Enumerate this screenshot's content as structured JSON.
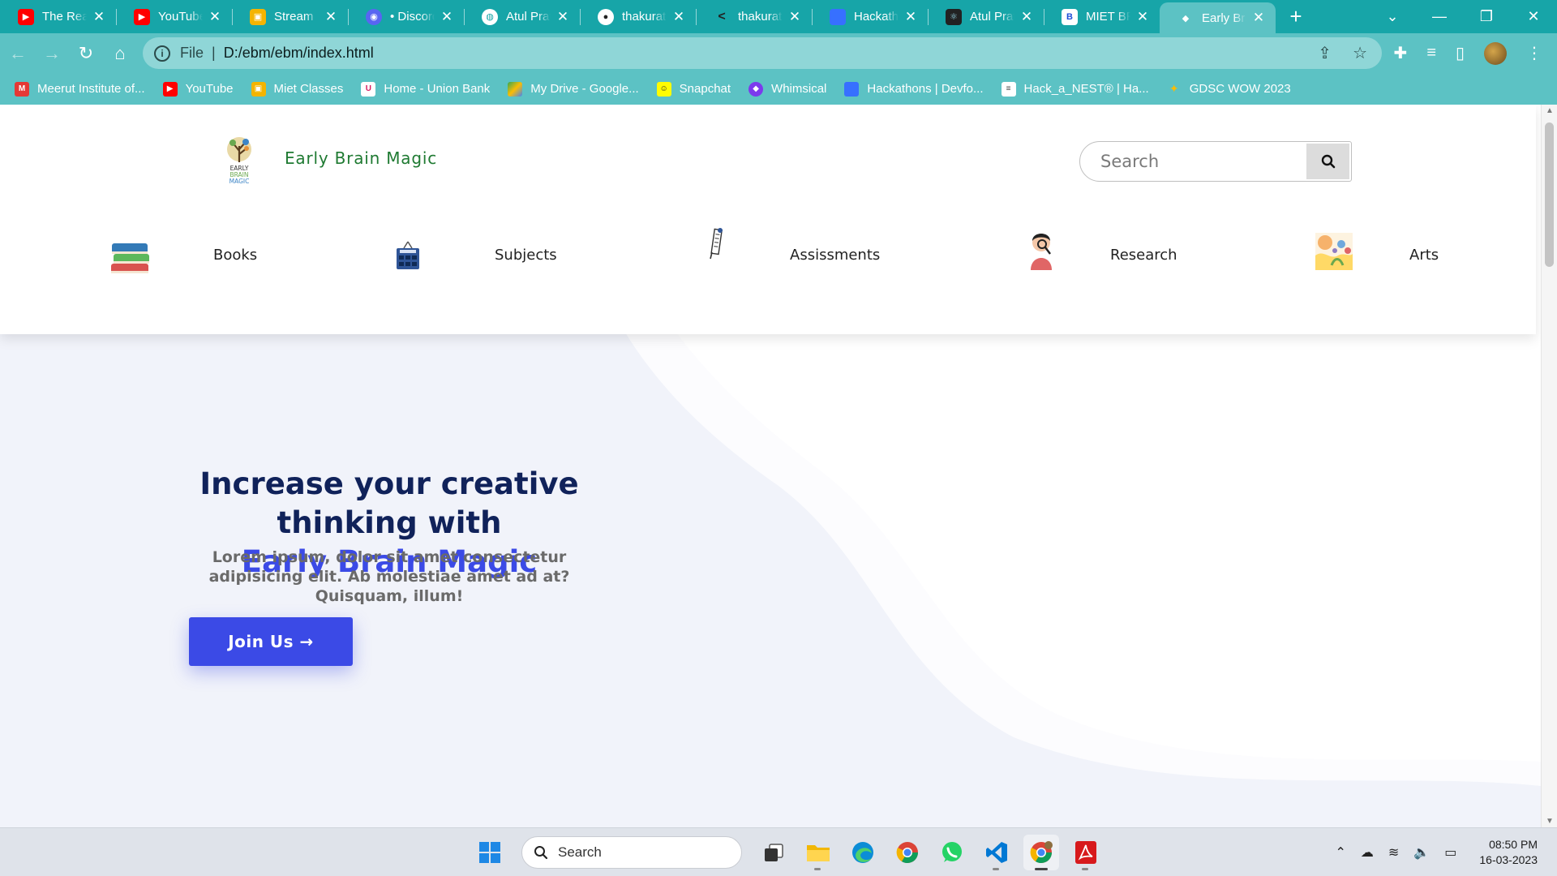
{
  "browser": {
    "tabs": [
      {
        "label": "The Real",
        "icon": "youtube-icon",
        "color": "#ff0000"
      },
      {
        "label": "YouTube",
        "icon": "youtube-icon",
        "color": "#ff0000"
      },
      {
        "label": "Stream",
        "icon": "classroom-icon",
        "color": "#f4b400"
      },
      {
        "label": "• Discord",
        "icon": "discord-icon",
        "color": "#5865f2"
      },
      {
        "label": "Atul Prata",
        "icon": "globe-icon",
        "color": "#ffffff"
      },
      {
        "label": "thakuratu",
        "icon": "github-icon",
        "color": "#ffffff"
      },
      {
        "label": "thakuratu",
        "icon": "leetcode-icon",
        "color": "#ffa116"
      },
      {
        "label": "Hackatho",
        "icon": "devfolio-icon",
        "color": "#3770ff"
      },
      {
        "label": "Atul Prata",
        "icon": "react-icon",
        "color": "#222222"
      },
      {
        "label": "MIET BR",
        "icon": "miet-icon",
        "color": "#1d4ed8"
      },
      {
        "label": "Early Brai",
        "icon": "ebm-icon",
        "color": "#7aa33a",
        "active": true
      }
    ],
    "address": {
      "scheme": "File",
      "url": "D:/ebm/ebm/index.html"
    },
    "bookmarks": [
      {
        "label": "Meerut Institute of...",
        "color": "#e53935"
      },
      {
        "label": "YouTube",
        "color": "#ff0000"
      },
      {
        "label": "Miet Classes",
        "color": "#f4b400"
      },
      {
        "label": "Home - Union Bank",
        "color": "#d81b60"
      },
      {
        "label": "My Drive - Google...",
        "color": "#34a853"
      },
      {
        "label": "Snapchat",
        "color": "#fffc00"
      },
      {
        "label": "Whimsical",
        "color": "#7c3aed"
      },
      {
        "label": "Hackathons | Devfo...",
        "color": "#3770ff"
      },
      {
        "label": "Hack_a_NEST® | Ha...",
        "color": "#ffffff"
      },
      {
        "label": "GDSC WOW 2023",
        "color": "#fbbc04"
      }
    ]
  },
  "site": {
    "brand": "Early Brain Magic",
    "logo_text": [
      "EARLY",
      "BRAIN",
      "MAGIC"
    ],
    "search_placeholder": "Search",
    "nav": [
      {
        "label": "Books",
        "icon": "books-icon"
      },
      {
        "label": "Subjects",
        "icon": "library-icon"
      },
      {
        "label": "Assissments",
        "icon": "assessment-icon"
      },
      {
        "label": "Research",
        "icon": "research-icon"
      },
      {
        "label": "Arts",
        "icon": "arts-icon"
      }
    ],
    "hero": {
      "title_line1": "Increase your creative thinking with",
      "title_line2": "Early Brain Magic",
      "subtitle": "Lorem ipsum, dolor sit amet consectetur adipisicing elit. Ab molestiae amet ad at? Quisquam, illum!",
      "cta": "Join Us →"
    }
  },
  "taskbar": {
    "search_label": "Search",
    "apps": [
      "windows-start",
      "task-view",
      "file-explorer",
      "edge",
      "chrome",
      "whatsapp",
      "vscode",
      "chrome-profile",
      "acrobat"
    ],
    "time": "08:50 PM",
    "date": "16-03-2023"
  },
  "colors": {
    "browser_frame": "#17a5a8",
    "toolbar": "#5cc2c4",
    "brand_green": "#1f7a32",
    "hero_navy": "#10225a",
    "accent_blue": "#3b4ae6"
  }
}
